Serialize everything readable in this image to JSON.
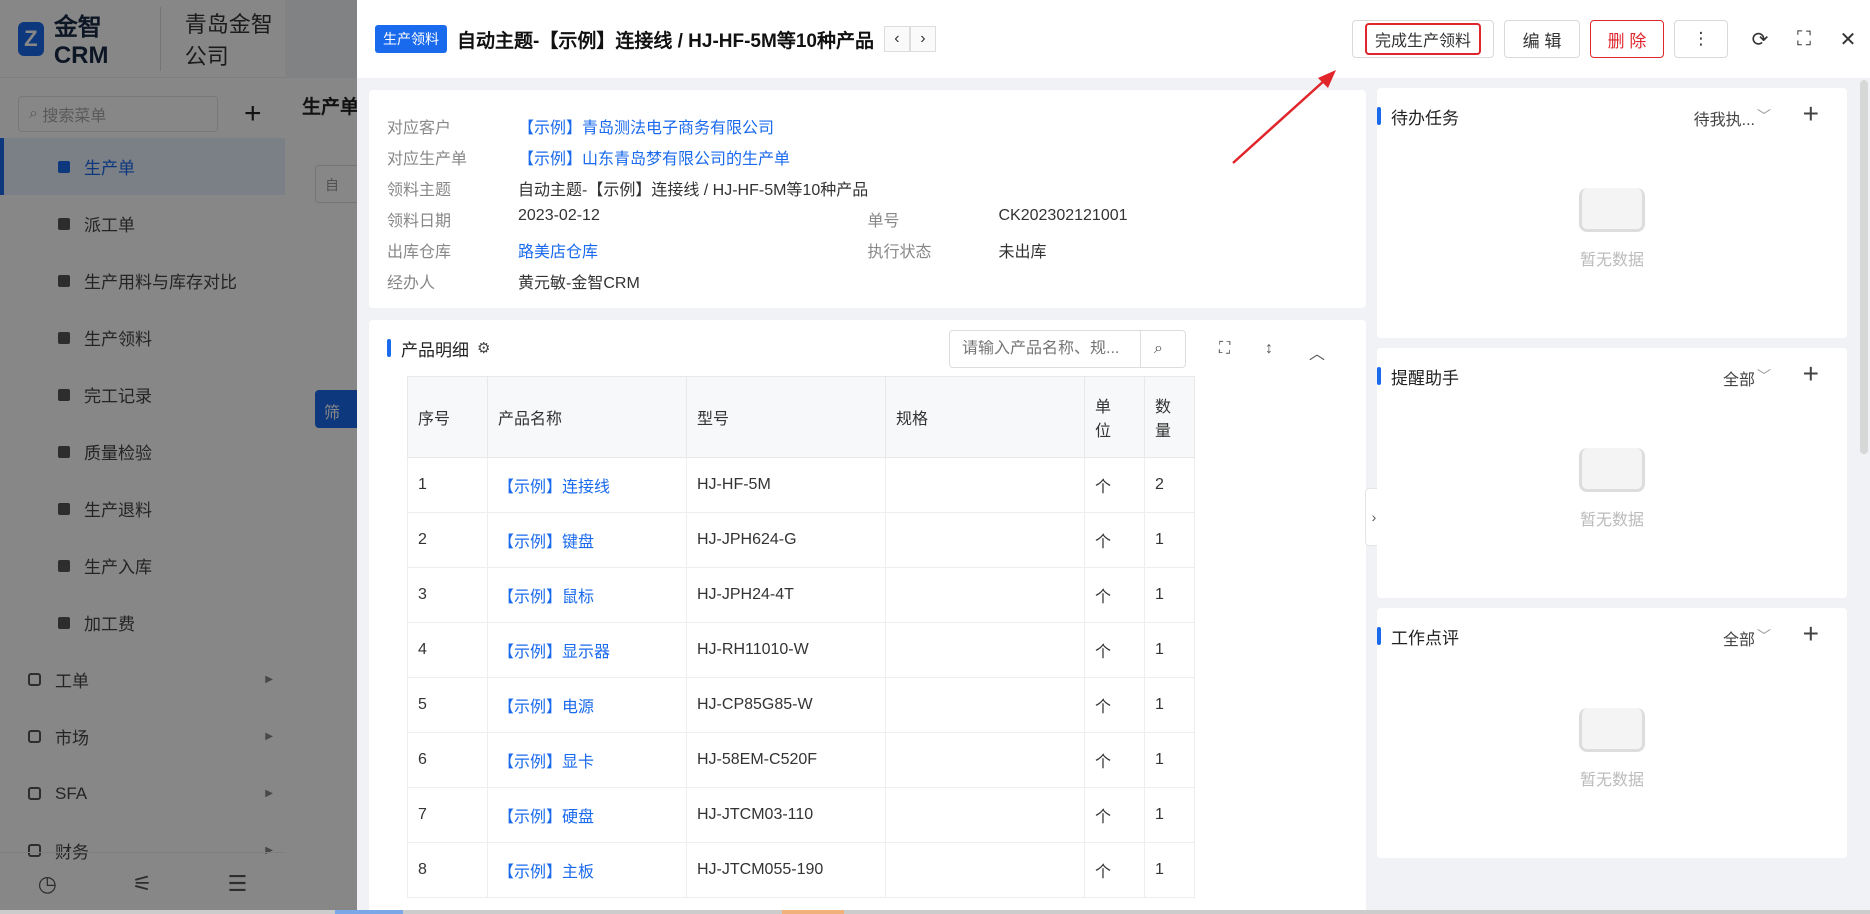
{
  "app": {
    "logo_mark": "Z",
    "logo": "金智CRM",
    "company": "青岛金智公司"
  },
  "sidebar": {
    "search_placeholder": "搜索菜单",
    "plus": "+",
    "items": [
      {
        "label": "生产单",
        "icon": "doc-icon",
        "active": true
      },
      {
        "label": "派工单",
        "icon": "person-icon"
      },
      {
        "label": "生产用料与库存对比",
        "icon": "pie-icon"
      },
      {
        "label": "生产领料",
        "icon": "doc-icon"
      },
      {
        "label": "完工记录",
        "icon": "edit-icon"
      },
      {
        "label": "质量检验",
        "icon": "shield-icon"
      },
      {
        "label": "生产退料",
        "icon": "doc-icon"
      },
      {
        "label": "生产入库",
        "icon": "user-icon"
      },
      {
        "label": "加工费",
        "icon": "box-icon"
      }
    ],
    "groups": [
      "工单",
      "市场",
      "SFA",
      "财务"
    ],
    "bottom_icons": [
      "history-icon",
      "filter-icon",
      "menu-icon"
    ]
  },
  "mid": {
    "title": "生产单",
    "input_placeholder": "自动",
    "input_label": "自",
    "button": "筛"
  },
  "header": {
    "badge": "生产领料",
    "title": "自动主题-【示例】连接线 / HJ-HF-5M等10种产品",
    "prev": "‹",
    "next": "›",
    "actions": {
      "complete": "完成生产领料",
      "edit": "编 辑",
      "delete": "删 除",
      "more": "⋮"
    },
    "icons": [
      "refresh-icon",
      "fullscreen-icon",
      "close-icon"
    ],
    "refresh_glyph": "⟳",
    "full_glyph": "⛶",
    "close_glyph": "✕"
  },
  "info": {
    "customer_label": "对应客户",
    "customer": "【示例】青岛测法电子商务有限公司",
    "order_label": "对应生产单",
    "order": "【示例】山东青岛梦有限公司的生产单",
    "subject_label": "领料主题",
    "subject": "自动主题-【示例】连接线 / HJ-HF-5M等10种产品",
    "date_label": "领料日期",
    "date": "2023-02-12",
    "no_label": "单号",
    "no": "CK202302121001",
    "warehouse_label": "出库仓库",
    "warehouse": "路美店仓库",
    "status_label": "执行状态",
    "status": "未出库",
    "handler_label": "经办人",
    "handler": "黄元敏-金智CRM"
  },
  "products": {
    "title": "产品明细",
    "gear": "⚙",
    "search_placeholder": "请输入产品名称、规...",
    "search_glyph": "⌕",
    "expand_glyph": "⛶",
    "sort_glyph": "↕",
    "collapse_glyph": "︿",
    "columns": [
      "序号",
      "产品名称",
      "型号",
      "规格",
      "单\n位",
      "数量"
    ],
    "rows": [
      [
        "1",
        "【示例】连接线",
        "HJ-HF-5M",
        "",
        "个",
        "2"
      ],
      [
        "2",
        "【示例】键盘",
        "HJ-JPH624-G",
        "",
        "个",
        "1"
      ],
      [
        "3",
        "【示例】鼠标",
        "HJ-JPH24-4T",
        "",
        "个",
        "1"
      ],
      [
        "4",
        "【示例】显示器",
        "HJ-RH11010-W",
        "",
        "个",
        "1"
      ],
      [
        "5",
        "【示例】电源",
        "HJ-CP85G85-W",
        "",
        "个",
        "1"
      ],
      [
        "6",
        "【示例】显卡",
        "HJ-58EM-C520F",
        "",
        "个",
        "1"
      ],
      [
        "7",
        "【示例】硬盘",
        "HJ-JTCM03-110",
        "",
        "个",
        "1"
      ],
      [
        "8",
        "【示例】主板",
        "HJ-JTCM055-190",
        "",
        "个",
        "1"
      ]
    ]
  },
  "right": {
    "collapse_glyph": "›",
    "cards": [
      {
        "title": "待办任务",
        "filter": "待我执...",
        "empty": "暂无数据",
        "plus": "+",
        "chev": "﹀"
      },
      {
        "title": "提醒助手",
        "filter": "全部",
        "empty": "暂无数据",
        "plus": "+",
        "chev": "﹀"
      },
      {
        "title": "工作点评",
        "filter": "全部",
        "empty": "暂无数据",
        "plus": "+",
        "chev": "﹀"
      }
    ]
  },
  "colors": {
    "accent": "#1a6aed",
    "danger": "#e0262b",
    "annotation": "#e0262b"
  }
}
